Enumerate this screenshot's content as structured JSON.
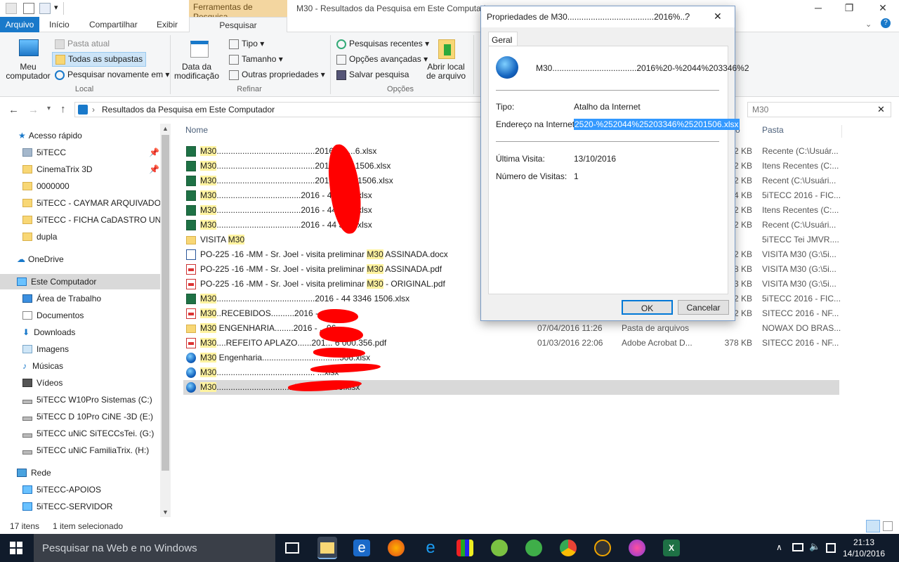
{
  "window": {
    "title": "M30 - Resultados da Pesquisa em Este Computador",
    "context_tab": "Ferramentas de Pesquisa"
  },
  "ribbon_tabs": [
    "Arquivo",
    "Início",
    "Compartilhar",
    "Exibir",
    "Pesquisar"
  ],
  "ribbon": {
    "meu_computador": "Meu computador",
    "pasta_atual": "Pasta atual",
    "todas_subpastas": "Todas as subpastas",
    "pesquisar_novamente": "Pesquisar novamente em",
    "data_modificacao": "Data da modificação",
    "tipo": "Tipo",
    "tamanho": "Tamanho",
    "outras_propriedades": "Outras propriedades",
    "pesquisas_recentes": "Pesquisas recentes",
    "opcoes_avancadas": "Opções avançadas",
    "salvar_pesquisa": "Salvar pesquisa",
    "abrir_local": "Abrir local de arquivo",
    "groups": {
      "local": "Local",
      "refinar": "Refinar",
      "opcoes": "Opções"
    }
  },
  "address": {
    "path": "Resultados da Pesquisa em Este Computador",
    "search_value": "M30"
  },
  "nav": {
    "acesso_rapido": "Acesso rápido",
    "pinned": [
      "5iTECC",
      "CinemaTrix 3D",
      "0000000",
      "5iTECC - CAYMAR ARQUIVADO 2",
      "5iTECC - FICHA CaDASTRO UNIC",
      "dupla"
    ],
    "onedrive": "OneDrive",
    "este_computador": "Este Computador",
    "pc_items": [
      "Área de Trabalho",
      "Documentos",
      "Downloads",
      "Imagens",
      "Músicas",
      "Vídeos",
      "5iTECC W10Pro Sistemas (C:)",
      "5iTECC D 10Pro CiNE -3D (E:)",
      "5iTECC uNiC SiTECCsTei. (G:)",
      "5iTECC uNiC FamiliaTrix. (H:)"
    ],
    "rede": "Rede",
    "network": [
      "5iTECC-APOIOS",
      "5iTECC-SERVIDOR"
    ]
  },
  "columns": {
    "name": "Nome",
    "folder": "Pasta",
    "size_short": "o"
  },
  "files": [
    {
      "pre": "",
      "hl": "M30",
      "post": "..........................................2016 - 4 ...6.xlsx",
      "size": "2 KB",
      "folder": "Recente (C:\\Usuár...",
      "icon": "xl-doc",
      "date": "",
      "type": ""
    },
    {
      "pre": "",
      "hl": "M30",
      "post": "..........................................2016 - 4 ...1506.xlsx",
      "size": "2 KB",
      "folder": "Itens Recentes (C:...",
      "icon": "xl",
      "date": "",
      "type": ""
    },
    {
      "pre": "",
      "hl": "M30",
      "post": "..........................................2016 - 4 ... 1506.xlsx",
      "size": "2 KB",
      "folder": "Recent (C:\\Usuári...",
      "icon": "xl",
      "date": "",
      "type": ""
    },
    {
      "pre": "",
      "hl": "M30",
      "post": "....................................2016 - 44 3...5.xlsx",
      "size": "4 KB",
      "folder": "5iTECC 2016 - FIC...",
      "icon": "xl",
      "date": "",
      "type": ""
    },
    {
      "pre": "",
      "hl": "M30",
      "post": "....................................2016 - 44 3...5.xlsx",
      "size": "2 KB",
      "folder": "Itens Recentes (C:...",
      "icon": "xl",
      "date": "",
      "type": ""
    },
    {
      "pre": "",
      "hl": "M30",
      "post": "....................................2016 - 44 3...5.xlsx",
      "size": "2 KB",
      "folder": "Recent (C:\\Usuári...",
      "icon": "xl",
      "date": "",
      "type": ""
    },
    {
      "pre": "VISITA ",
      "hl": "M30",
      "post": "",
      "size": "",
      "folder": "5iTECC Tei JMVR....",
      "icon": "fol",
      "date": "",
      "type": ""
    },
    {
      "pre": "PO-225 -16 -MM - Sr. Joel - visita preliminar ",
      "hl": "M30",
      "post": " ASSINADA.docx",
      "size": "2 KB",
      "folder": "VISITA M30 (G:\\5i...",
      "icon": "doc",
      "date": "",
      "type": ""
    },
    {
      "pre": "PO-225 -16 -MM - Sr. Joel - visita preliminar ",
      "hl": "M30",
      "post": " ASSINADA.pdf",
      "size": "8 KB",
      "folder": "VISITA M30 (G:\\5i...",
      "icon": "pdf",
      "date": "",
      "type": ""
    },
    {
      "pre": "PO-225 -16 -MM - Sr. Joel - visita preliminar ",
      "hl": "M30",
      "post": " - ORIGINAL.pdf",
      "size": "3 KB",
      "folder": "VISITA M30 (G:\\5i...",
      "icon": "pdf",
      "date": "",
      "type": ""
    },
    {
      "pre": "",
      "hl": "M30",
      "post": "..........................................2016 - 44 3346 1506.xlsx",
      "size": "2 KB",
      "folder": "5iTECC 2016 - FIC...",
      "icon": "xl",
      "date": "",
      "type": ""
    },
    {
      "pre": "",
      "hl": "M30",
      "post": "..RECEBIDOS..........2016 - ...6.pdf",
      "size": "2 KB",
      "folder": "SITECC 2016 - NF...",
      "icon": "pdf",
      "date": "",
      "type": ""
    },
    {
      "pre": "",
      "hl": "M30",
      "post": " ENGENHARIA........2016 - ...06",
      "size": "",
      "folder": "NOWAX DO BRAS...",
      "icon": "fol",
      "date": "07/04/2016 11:26",
      "type": "Pasta de arquivos"
    },
    {
      "pre": "",
      "hl": "M30",
      "post": "....REFEITO APLAZO......201... 6 000.356.pdf",
      "size": "378 KB",
      "folder": "SITECC 2016 - NF...",
      "icon": "pdf",
      "date": "01/03/2016 22:06",
      "type": "Adobe Acrobat D..."
    },
    {
      "pre": "",
      "hl": "M30",
      "post": " Engenharia.................................506.xlsx",
      "size": "",
      "folder": "",
      "icon": "globe",
      "date": "",
      "type": ""
    },
    {
      "pre": "",
      "hl": "M30",
      "post": ".......................................... ...xlsx",
      "size": "",
      "folder": "",
      "icon": "globe",
      "date": "",
      "type": ""
    },
    {
      "pre": "",
      "hl": "M30",
      "post": ".................................2016 ... 1506.xlsx",
      "size": "",
      "folder": "",
      "icon": "globe",
      "date": "",
      "type": ""
    }
  ],
  "status": {
    "count": "17 itens",
    "selected": "1 item selecionado"
  },
  "dialog": {
    "title": "Propriedades de M30.....................................2016%...",
    "help": "?",
    "tab": "Geral",
    "file_name": "M30....................................2016%20-%2044%203346%2",
    "tipo_label": "Tipo:",
    "tipo_value": "Atalho da Internet",
    "endereco_label": "Endereço na Internet:",
    "endereco_value": "2520-%252044%25203346%25201506.xlsx",
    "ultima_label": "Última Visita:",
    "ultima_value": "13/10/2016",
    "numero_label": "Número de Visitas:",
    "numero_value": "1",
    "ok": "OK",
    "cancel": "Cancelar"
  },
  "taskbar": {
    "search_placeholder": "Pesquisar na Web e no Windows",
    "time": "21:13",
    "date": "14/10/2016"
  },
  "colors": {
    "accent": "#1979ca",
    "highlight": "#fff3a0",
    "redaction": "#ff0000",
    "taskbar": "#101b2b"
  }
}
